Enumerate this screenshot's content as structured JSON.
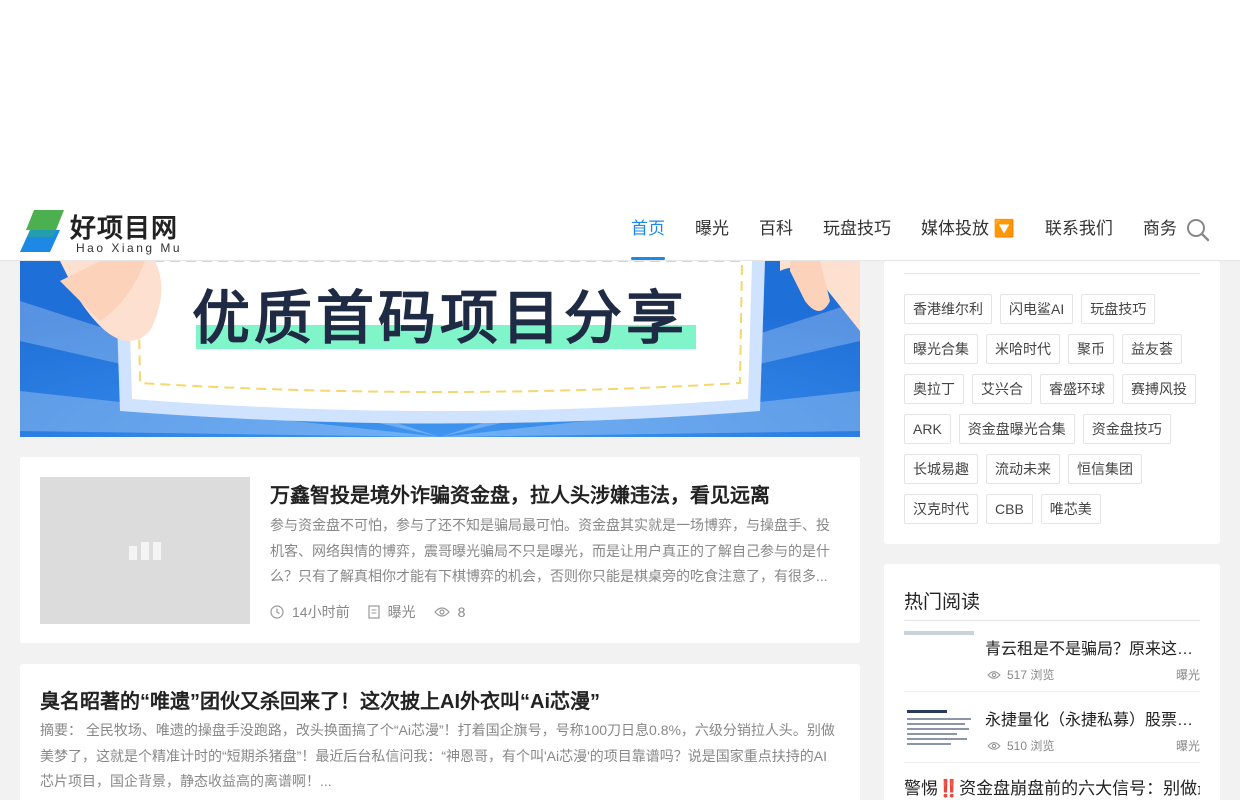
{
  "header": {
    "logo_text": "好项目网",
    "logo_pinyin": "Hao Xiang Mu",
    "nav": [
      {
        "label": "首页",
        "active": true
      },
      {
        "label": "曝光"
      },
      {
        "label": "百科"
      },
      {
        "label": "玩盘技巧"
      },
      {
        "label": "媒体投放 🔽"
      },
      {
        "label": "联系我们"
      },
      {
        "label": "商务"
      }
    ],
    "search_icon": "search-icon"
  },
  "banner": {
    "text": "优质首码项目分享"
  },
  "posts": [
    {
      "title": "万鑫智投是境外诈骗资金盘，拉人头涉嫌违法，看见远离",
      "excerpt": "参与资金盘不可怕，参与了还不知是骗局最可怕。资金盘其实就是一场博弈，与操盘手、投机客、网络舆情的博弈，震哥曝光骗局不只是曝光，而是让用户真正的了解自己参与的是什么？只有了解真相你才能有下棋博弈的机会，否则你只能是棋桌旁的吃食注意了，有很多...",
      "time": "14小时前",
      "category": "曝光",
      "views": "8"
    },
    {
      "title": "臭名昭著的“唯遗”团伙又杀回来了！这次披上AI外衣叫“Ai芯漫”",
      "excerpt": "摘要： 全民牧场、唯遗的操盘手没跑路，改头换面搞了个“Ai芯漫”！打着国企旗号，号称100刀日息0.8%，六级分销拉人头。别做美梦了，这就是个精准计时的“短期杀猪盘”！最近后台私信问我：“神恩哥，有个叫'Ai芯漫'的项目靠谱吗？说是国家重点扶持的AI芯片项目，国企背景，静态收益高的离谱啊！..."
    }
  ],
  "sidebar": {
    "tags": [
      "香港维尔利",
      "闪电鲨AI",
      "玩盘技巧",
      "曝光合集",
      "米哈时代",
      "聚币",
      "益友荟",
      "奥拉丁",
      "艾兴合",
      "睿盛环球",
      "赛搏风投",
      "ARK",
      "资金盘曝光合集",
      "资金盘技巧",
      "长城易趣",
      "流动未来",
      "恒信集团",
      "汉克时代",
      "CBB",
      "唯芯美"
    ],
    "hot": {
      "title": "热门阅读",
      "items": [
        {
          "title": "青云租是不是骗局？原来这是一个资金盘",
          "views": "517 浏览",
          "category": "曝光"
        },
        {
          "title": "永捷量化（永捷私募）股票配资平台骗局",
          "views": "510 浏览",
          "category": "曝光"
        },
        {
          "title": "警惕‼️资金盘崩盘前的六大信号：别做最"
        }
      ]
    }
  },
  "colors": {
    "accent": "#1e88e5",
    "banner_blue": "#2a7fe4",
    "highlight_green": "#7ff5c9",
    "logo_green": "#4caf50",
    "logo_blue": "#1e88e5"
  }
}
